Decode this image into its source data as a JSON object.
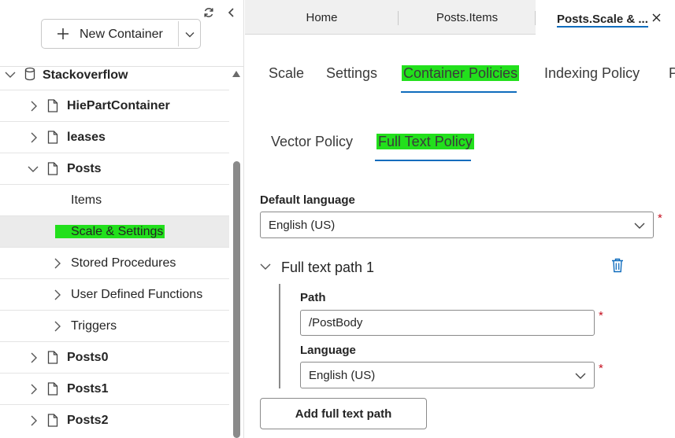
{
  "sidebar": {
    "new_container_label": "New Container",
    "tree": {
      "database": "Stackoverflow",
      "containers": [
        "HiePartContainer",
        "leases",
        "Posts"
      ],
      "posts_children": [
        "Items",
        "Scale & Settings",
        "Stored Procedures",
        "User Defined Functions",
        "Triggers"
      ],
      "more_containers": [
        "Posts0",
        "Posts1",
        "Posts2"
      ]
    }
  },
  "tabs": {
    "home": "Home",
    "posts_items": "Posts.Items",
    "posts_scale": "Posts.Scale & ..."
  },
  "settings_tabs": [
    "Scale",
    "Settings",
    "Container Policies",
    "Indexing Policy",
    "P"
  ],
  "policy_tabs": [
    "Vector Policy",
    "Full Text Policy"
  ],
  "form": {
    "default_language_label": "Default language",
    "default_language_value": "English (US)",
    "path_section_title": "Full text path 1",
    "path_label": "Path",
    "path_value": "/PostBody",
    "language_label": "Language",
    "language_value": "English (US)",
    "required_mark": "*",
    "add_path_button": "Add full text path"
  },
  "colors": {
    "accent": "#0f6cbd",
    "highlight": "#22e01c",
    "delete_icon": "#0f6cbd",
    "required": "#c50f1f"
  }
}
